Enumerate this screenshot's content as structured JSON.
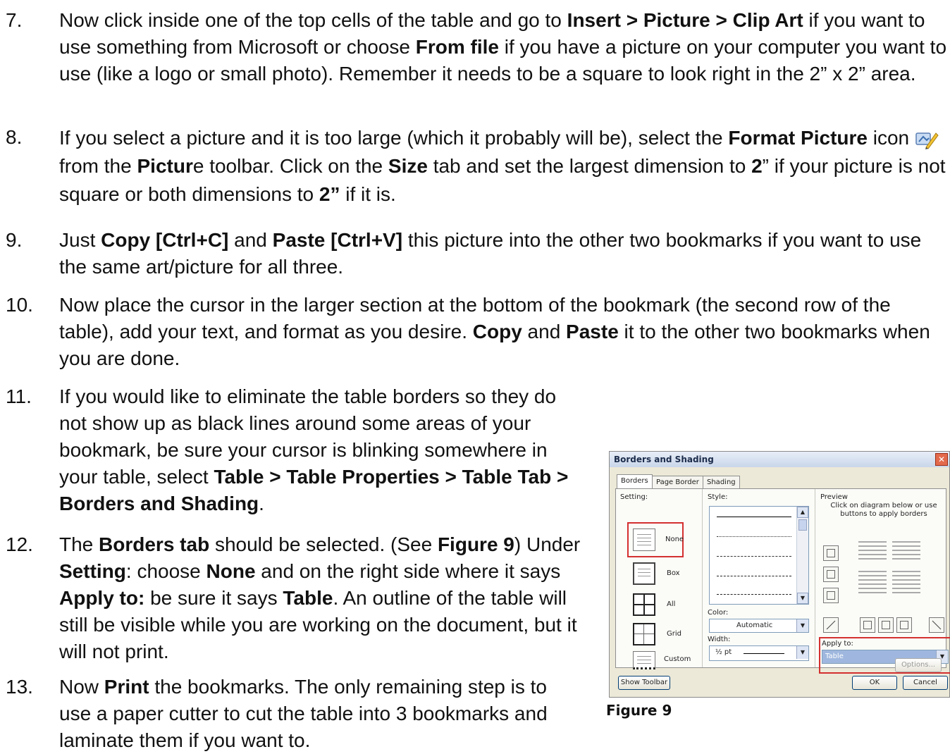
{
  "steps": [
    {
      "number": "7.",
      "parts": [
        {
          "t": "Now click inside one of the top cells of the table and go to ",
          "b": false
        },
        {
          "t": "Insert > Picture > Clip Art",
          "b": true
        },
        {
          "t": " if you want to use something from Microsoft or choose ",
          "b": false
        },
        {
          "t": "From file",
          "b": true
        },
        {
          "t": " if you have a picture on your computer you want to use (like a logo or small photo). Remember it needs to be a square to look right in the 2” x 2” area.",
          "b": false
        }
      ]
    },
    {
      "number": "8.",
      "parts": [
        {
          "t": "If you select a picture and it is too large (which it probably will be), select the ",
          "b": false
        },
        {
          "t": "Format Picture",
          "b": true
        },
        {
          "t": " icon ",
          "b": false
        },
        {
          "t": " from the ",
          "b": false
        },
        {
          "t": "Pictur",
          "b": true
        },
        {
          "t": "e toolbar. Click on the ",
          "b": false
        },
        {
          "t": "Size",
          "b": true
        },
        {
          "t": " tab and set the largest dimension to ",
          "b": false
        },
        {
          "t": "2",
          "b": true
        },
        {
          "t": "” if your picture is not square or both dimensions to ",
          "b": false
        },
        {
          "t": "2”",
          "b": true
        },
        {
          "t": " if it is.",
          "b": false
        }
      ],
      "icon": "format-picture-icon"
    },
    {
      "number": "9.",
      "parts": [
        {
          "t": "Just ",
          "b": false
        },
        {
          "t": "Copy [Ctrl+C]",
          "b": true
        },
        {
          "t": " and ",
          "b": false
        },
        {
          "t": "Paste [Ctrl+V]",
          "b": true
        },
        {
          "t": " this picture into the other two bookmarks if you want to use the same art/picture for all three.",
          "b": false
        }
      ]
    },
    {
      "number": "10.",
      "parts": [
        {
          "t": "Now place the cursor in the larger section at the bottom of the bookmark (the second row of the table), add your text, and format as you desire. ",
          "b": false
        },
        {
          "t": "Copy",
          "b": true
        },
        {
          "t": " and ",
          "b": false
        },
        {
          "t": "Paste",
          "b": true
        },
        {
          "t": " it to the other two bookmarks when you are done.",
          "b": false
        }
      ]
    },
    {
      "number": "11.",
      "parts": [
        {
          "t": "If you would like to eliminate the table borders so they do not show up as black lines around some areas of your bookmark, be sure your cursor is blinking somewhere in your table, select ",
          "b": false
        },
        {
          "t": "Table > Table  Properties > Table Tab > Borders and Shading",
          "b": true
        },
        {
          "t": ".",
          "b": false
        }
      ]
    },
    {
      "number": "12.",
      "parts": [
        {
          "t": "The ",
          "b": false
        },
        {
          "t": "Borders tab",
          "b": true
        },
        {
          "t": " should be selected. (See ",
          "b": false
        },
        {
          "t": "Figure 9",
          "b": true
        },
        {
          "t": ") Under ",
          "b": false
        },
        {
          "t": "Setting",
          "b": true
        },
        {
          "t": ": choose ",
          "b": false
        },
        {
          "t": "None",
          "b": true
        },
        {
          "t": " and on the right side where it says ",
          "b": false
        },
        {
          "t": "Apply to:",
          "b": true
        },
        {
          "t": " be sure it says ",
          "b": false
        },
        {
          "t": "Table",
          "b": true
        },
        {
          "t": ". An outline of the table will still be visible while you are working on the document, but it will not print.",
          "b": false
        }
      ]
    },
    {
      "number": "13.",
      "parts": [
        {
          "t": "Now ",
          "b": false
        },
        {
          "t": "Print",
          "b": true
        },
        {
          "t": " the bookmarks. The only remaining step is to use a paper cutter to cut the table into 3 bookmarks and laminate them if you want to.",
          "b": false
        }
      ]
    }
  ],
  "figure": {
    "caption": "Figure 9",
    "dialog": {
      "title": "Borders and Shading",
      "tabs": [
        "Borders",
        "Page Border",
        "Shading"
      ],
      "setting_label": "Setting:",
      "settings": [
        "None",
        "Box",
        "All",
        "Grid",
        "Custom"
      ],
      "style_label": "Style:",
      "color_label": "Color:",
      "color_value": "Automatic",
      "width_label": "Width:",
      "width_value": "½ pt",
      "preview_label": "Preview",
      "preview_hint": "Click on diagram below or use buttons to apply borders",
      "apply_label": "Apply to:",
      "apply_value": "Table",
      "options_button": "Options...",
      "show_toolbar_button": "Show Toolbar",
      "ok_button": "OK",
      "cancel_button": "Cancel",
      "highlight_color": "#d43030"
    }
  }
}
